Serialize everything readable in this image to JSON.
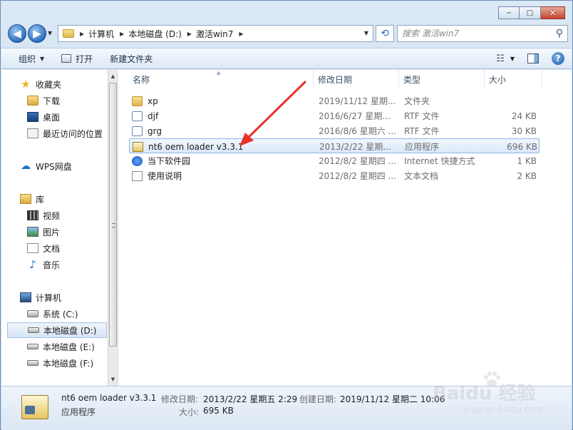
{
  "window": {
    "minimize": "−",
    "maximize": "□",
    "close": "✕"
  },
  "address": {
    "crumbs": [
      "计算机",
      "本地磁盘 (D:)",
      "激活win7"
    ]
  },
  "search": {
    "placeholder": "搜索 激活win7"
  },
  "toolbar": {
    "organize": "组织",
    "open": "打开",
    "new_folder": "新建文件夹"
  },
  "sidebar": {
    "favorites": {
      "label": "收藏夹",
      "items": [
        "下载",
        "桌面",
        "最近访问的位置"
      ]
    },
    "wps": "WPS网盘",
    "library": {
      "label": "库",
      "items": [
        "视频",
        "图片",
        "文档",
        "音乐"
      ]
    },
    "computer": {
      "label": "计算机",
      "items": [
        "系统 (C:)",
        "本地磁盘 (D:)",
        "本地磁盘 (E:)",
        "本地磁盘 (F:)"
      ]
    }
  },
  "columns": {
    "name": "名称",
    "date": "修改日期",
    "type": "类型",
    "size": "大小"
  },
  "files": [
    {
      "name": "xp",
      "date": "2019/11/12 星期...",
      "type": "文件夹",
      "size": "",
      "icon": "folder-icon"
    },
    {
      "name": "djf",
      "date": "2016/6/27 星期...",
      "type": "RTF 文件",
      "size": "24 KB",
      "icon": "rtf-file-icon"
    },
    {
      "name": "grg",
      "date": "2016/8/6 星期六 ...",
      "type": "RTF 文件",
      "size": "30 KB",
      "icon": "rtf-file-icon"
    },
    {
      "name": "nt6 oem loader v3.3.1",
      "date": "2013/2/22 星期...",
      "type": "应用程序",
      "size": "696 KB",
      "icon": "exe-icon",
      "selected": true
    },
    {
      "name": "当下软件园",
      "date": "2012/8/2 星期四 ...",
      "type": "Internet 快捷方式",
      "size": "1 KB",
      "icon": "internet-shortcut-icon"
    },
    {
      "name": "使用说明",
      "date": "2012/8/2 星期四 ...",
      "type": "文本文档",
      "size": "2 KB",
      "icon": "text-file-icon"
    }
  ],
  "details": {
    "name": "nt6 oem loader v3.3.1",
    "type": "应用程序",
    "modified_label": "修改日期:",
    "modified": "2013/2/22 星期五 2:29",
    "created_label": "创建日期:",
    "created": "2019/11/12 星期二 10:06",
    "size_label": "大小:",
    "size": "695 KB"
  },
  "watermark": {
    "text": "Baidu 经验",
    "sub": "jingyan.baidu.com"
  },
  "colors": {
    "arrow": "#e8322a",
    "selection": "#d9e8f9",
    "accent": "#2d6fc0"
  }
}
